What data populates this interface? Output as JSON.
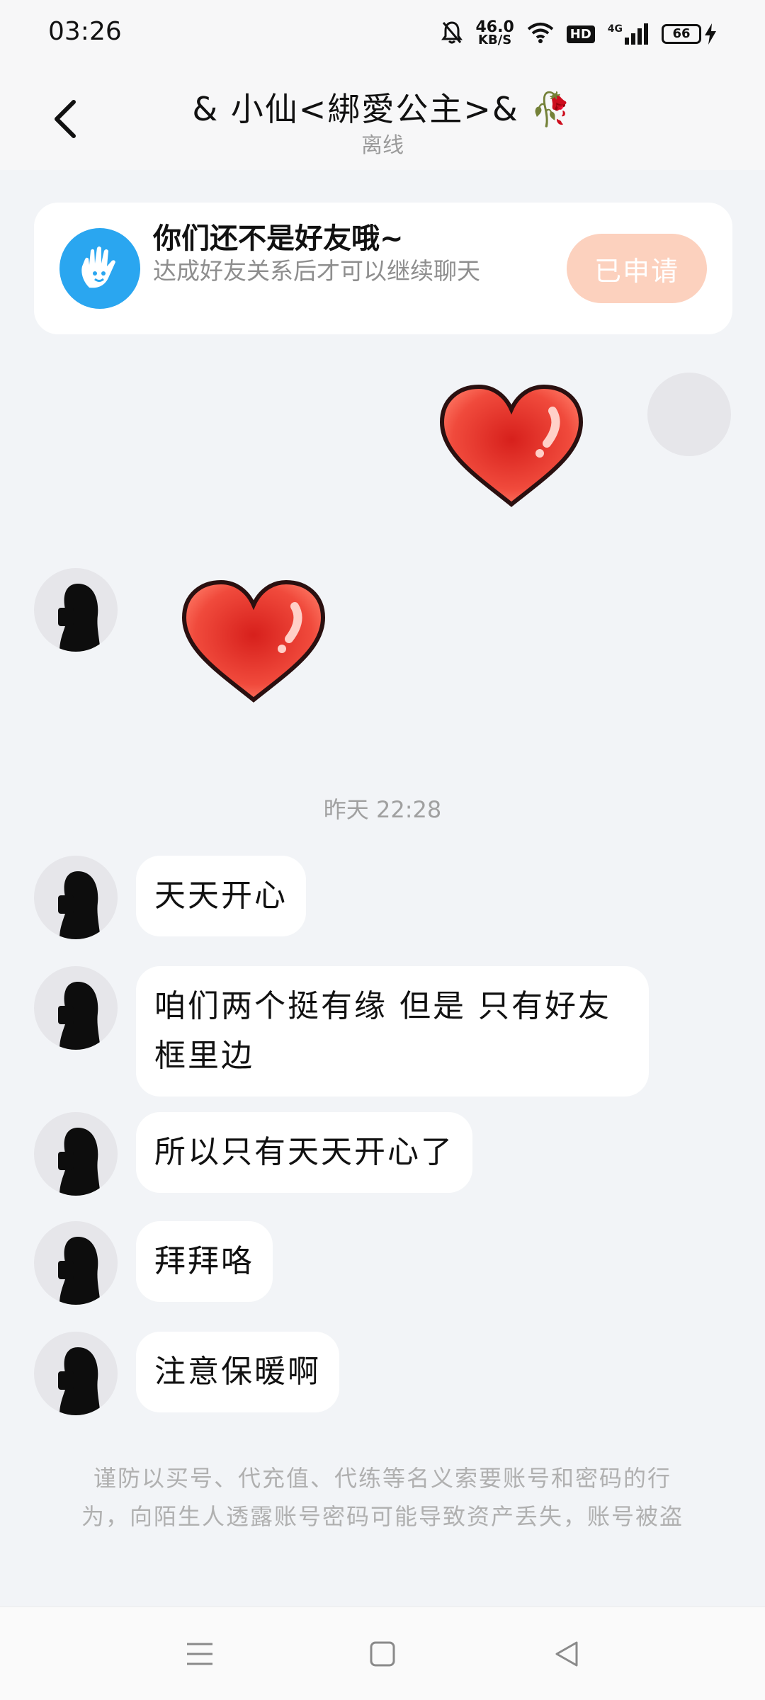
{
  "status_bar": {
    "time": "03:26",
    "net_speed_value": "46.0",
    "net_speed_unit": "KB/S",
    "hd": "HD",
    "network": "4G",
    "battery": "66"
  },
  "header": {
    "title": "& 小仙<綁愛公主>& 🥀",
    "subtitle": "离线"
  },
  "friend_banner": {
    "title": "你们还不是好友哦~",
    "description": "达成好友关系后才可以继续聊天",
    "button_label": "已申请"
  },
  "timestamp": "昨天 22:28",
  "messages": [
    {
      "text": "天天开心"
    },
    {
      "text": "咱们两个挺有缘 但是 只有好友框里边"
    },
    {
      "text": "所以只有天天开心了"
    },
    {
      "text": "拜拜咯"
    },
    {
      "text": "注意保暖啊"
    }
  ],
  "notice": "谨防以买号、代充值、代练等名义索要账号和密码的行为，向陌生人透露账号密码可能导致资产丢失，账号被盗",
  "colors": {
    "background": "#f2f4f7",
    "applied_button": "#fcd1be",
    "friend_icon": "#2aa6f0",
    "heart": "#e8322c"
  },
  "icons": {
    "back": "chevron-left-icon",
    "friend": "hand-wave-icon",
    "menu": "menu-icon",
    "home": "square-home-icon",
    "back_nav": "triangle-back-icon"
  }
}
